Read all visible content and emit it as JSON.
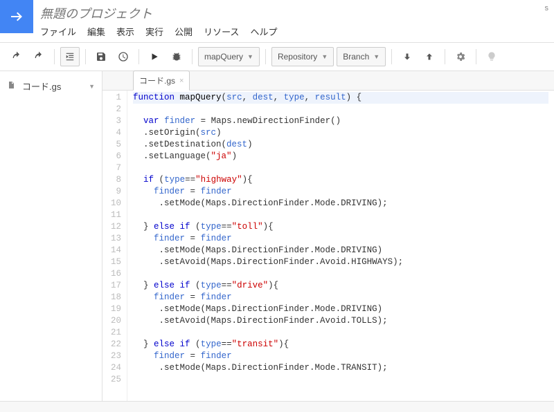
{
  "header": {
    "title": "無題のプロジェクト",
    "top_right": "s"
  },
  "menu": {
    "file": "ファイル",
    "edit": "編集",
    "view": "表示",
    "run": "実行",
    "publish": "公開",
    "resources": "リソース",
    "help": "ヘルプ"
  },
  "toolbar": {
    "function_select": "mapQuery",
    "repo_select": "Repository",
    "branch_select": "Branch"
  },
  "sidebar": {
    "files": [
      {
        "name": "コード.gs"
      }
    ]
  },
  "tab": {
    "label": "コード.gs"
  },
  "code": {
    "lines": [
      {
        "n": 1,
        "hl": true,
        "tokens": [
          [
            "k",
            "function"
          ],
          [
            "fn",
            " mapQuery"
          ],
          [
            "op",
            "("
          ],
          [
            "id",
            "src"
          ],
          [
            "op",
            ", "
          ],
          [
            "id",
            "dest"
          ],
          [
            "op",
            ", "
          ],
          [
            "id",
            "type"
          ],
          [
            "op",
            ", "
          ],
          [
            "id",
            "result"
          ],
          [
            "op",
            ") {"
          ]
        ]
      },
      {
        "n": 2,
        "tokens": []
      },
      {
        "n": 3,
        "tokens": [
          [
            "op",
            "  "
          ],
          [
            "k",
            "var"
          ],
          [
            "op",
            " "
          ],
          [
            "id",
            "finder"
          ],
          [
            "op",
            " = Maps.newDirectionFinder()"
          ]
        ]
      },
      {
        "n": 4,
        "tokens": [
          [
            "op",
            "  .setOrigin("
          ],
          [
            "id",
            "src"
          ],
          [
            "op",
            ")"
          ]
        ]
      },
      {
        "n": 5,
        "tokens": [
          [
            "op",
            "  .setDestination("
          ],
          [
            "id",
            "dest"
          ],
          [
            "op",
            ")"
          ]
        ]
      },
      {
        "n": 6,
        "tokens": [
          [
            "op",
            "  .setLanguage("
          ],
          [
            "s",
            "\"ja\""
          ],
          [
            "op",
            ")"
          ]
        ]
      },
      {
        "n": 7,
        "tokens": []
      },
      {
        "n": 8,
        "tokens": [
          [
            "op",
            "  "
          ],
          [
            "k",
            "if"
          ],
          [
            "op",
            " ("
          ],
          [
            "id",
            "type"
          ],
          [
            "op",
            "=="
          ],
          [
            "s",
            "\"highway\""
          ],
          [
            "op",
            "){"
          ]
        ]
      },
      {
        "n": 9,
        "tokens": [
          [
            "op",
            "    "
          ],
          [
            "id",
            "finder"
          ],
          [
            "op",
            " = "
          ],
          [
            "id",
            "finder"
          ]
        ]
      },
      {
        "n": 10,
        "tokens": [
          [
            "op",
            "     .setMode(Maps.DirectionFinder.Mode.DRIVING);"
          ]
        ]
      },
      {
        "n": 11,
        "tokens": []
      },
      {
        "n": 12,
        "tokens": [
          [
            "op",
            "  } "
          ],
          [
            "k",
            "else if"
          ],
          [
            "op",
            " ("
          ],
          [
            "id",
            "type"
          ],
          [
            "op",
            "=="
          ],
          [
            "s",
            "\"toll\""
          ],
          [
            "op",
            "){"
          ]
        ]
      },
      {
        "n": 13,
        "tokens": [
          [
            "op",
            "    "
          ],
          [
            "id",
            "finder"
          ],
          [
            "op",
            " = "
          ],
          [
            "id",
            "finder"
          ]
        ]
      },
      {
        "n": 14,
        "tokens": [
          [
            "op",
            "     .setMode(Maps.DirectionFinder.Mode.DRIVING)"
          ]
        ]
      },
      {
        "n": 15,
        "tokens": [
          [
            "op",
            "     .setAvoid(Maps.DirectionFinder.Avoid.HIGHWAYS);"
          ]
        ]
      },
      {
        "n": 16,
        "tokens": []
      },
      {
        "n": 17,
        "tokens": [
          [
            "op",
            "  } "
          ],
          [
            "k",
            "else if"
          ],
          [
            "op",
            " ("
          ],
          [
            "id",
            "type"
          ],
          [
            "op",
            "=="
          ],
          [
            "s",
            "\"drive\""
          ],
          [
            "op",
            "){"
          ]
        ]
      },
      {
        "n": 18,
        "tokens": [
          [
            "op",
            "    "
          ],
          [
            "id",
            "finder"
          ],
          [
            "op",
            " = "
          ],
          [
            "id",
            "finder"
          ]
        ]
      },
      {
        "n": 19,
        "tokens": [
          [
            "op",
            "     .setMode(Maps.DirectionFinder.Mode.DRIVING)"
          ]
        ]
      },
      {
        "n": 20,
        "tokens": [
          [
            "op",
            "     .setAvoid(Maps.DirectionFinder.Avoid.TOLLS);"
          ]
        ]
      },
      {
        "n": 21,
        "tokens": []
      },
      {
        "n": 22,
        "tokens": [
          [
            "op",
            "  } "
          ],
          [
            "k",
            "else if"
          ],
          [
            "op",
            " ("
          ],
          [
            "id",
            "type"
          ],
          [
            "op",
            "=="
          ],
          [
            "s",
            "\"transit\""
          ],
          [
            "op",
            "){"
          ]
        ]
      },
      {
        "n": 23,
        "tokens": [
          [
            "op",
            "    "
          ],
          [
            "id",
            "finder"
          ],
          [
            "op",
            " = "
          ],
          [
            "id",
            "finder"
          ]
        ]
      },
      {
        "n": 24,
        "tokens": [
          [
            "op",
            "     .setMode(Maps.DirectionFinder.Mode.TRANSIT);"
          ]
        ]
      },
      {
        "n": 25,
        "tokens": []
      }
    ]
  }
}
